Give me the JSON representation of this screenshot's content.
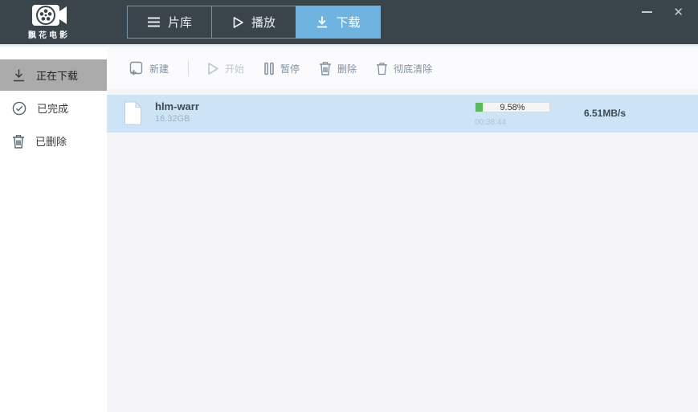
{
  "window": {
    "minimize": "minimize",
    "close": "✕"
  },
  "header": {
    "logo_text": "飘花电影",
    "tabs": [
      {
        "label": "片库",
        "icon": "library-list-icon",
        "active": false
      },
      {
        "label": "播放",
        "icon": "play-icon",
        "active": false
      },
      {
        "label": "下载",
        "icon": "download-icon",
        "active": true
      }
    ]
  },
  "sidebar": {
    "items": [
      {
        "label": "正在下载",
        "icon": "download-icon",
        "active": true
      },
      {
        "label": "已完成",
        "icon": "check-circle-icon",
        "active": false
      },
      {
        "label": "已删除",
        "icon": "trash-icon",
        "active": false
      }
    ]
  },
  "toolbar": {
    "buttons": [
      {
        "label": "新建",
        "icon": "new-task-icon",
        "disabled": false
      },
      {
        "label": "开始",
        "icon": "start-icon",
        "disabled": true
      },
      {
        "label": "暂停",
        "icon": "pause-icon",
        "disabled": false
      },
      {
        "label": "删除",
        "icon": "delete-icon",
        "disabled": false
      },
      {
        "label": "彻底清除",
        "icon": "purge-icon",
        "disabled": false
      }
    ]
  },
  "downloads": [
    {
      "name": "hlm-warr",
      "size": "16.32GB",
      "progress_percent": 9.58,
      "progress_label": "9.58%",
      "time": "00:38:44",
      "speed": "6.51MB/s"
    }
  ],
  "colors": {
    "header_bg": "#39444b",
    "active_tab_bg": "#6fb3e1",
    "sidebar_selected_bg": "#ababab",
    "row_highlight_bg": "#cde4f7",
    "progress_fill": "#5cb85c"
  }
}
